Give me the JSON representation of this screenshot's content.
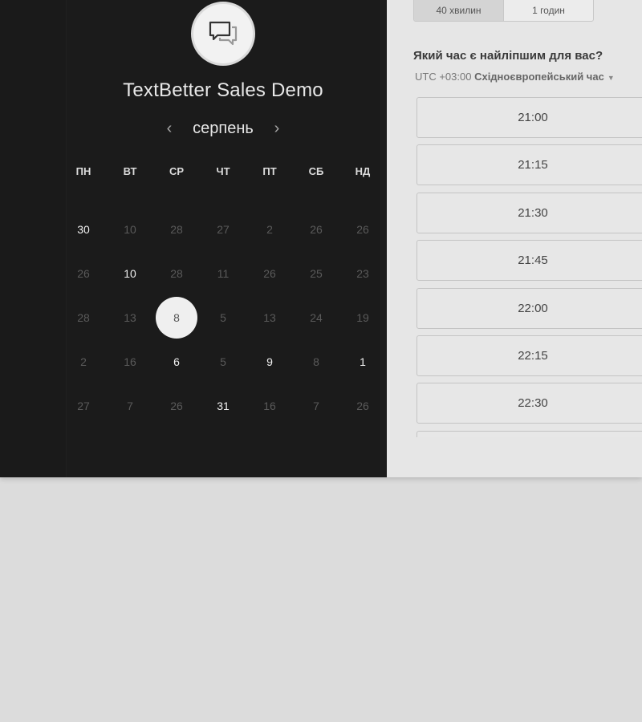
{
  "event": {
    "title": "TextBetter Sales Demo",
    "avatar_icon": "chat-bubbles-icon"
  },
  "calendar": {
    "month": "серпень",
    "weekdays": [
      "ПН",
      "ВТ",
      "СР",
      "ЧТ",
      "ПТ",
      "СБ",
      "НД"
    ],
    "weeks": [
      [
        {
          "d": "30",
          "on": true
        },
        {
          "d": "10",
          "on": false
        },
        {
          "d": "28",
          "on": false
        },
        {
          "d": "27",
          "on": false
        },
        {
          "d": "2",
          "on": false
        },
        {
          "d": "26",
          "on": false
        },
        {
          "d": "26",
          "on": false
        }
      ],
      [
        {
          "d": "26",
          "on": false
        },
        {
          "d": "10",
          "on": true
        },
        {
          "d": "28",
          "on": false
        },
        {
          "d": "11",
          "on": false
        },
        {
          "d": "26",
          "on": false
        },
        {
          "d": "25",
          "on": false
        },
        {
          "d": "23",
          "on": false
        }
      ],
      [
        {
          "d": "28",
          "on": false
        },
        {
          "d": "13",
          "on": false
        },
        {
          "d": "8",
          "on": true,
          "selected": true
        },
        {
          "d": "5",
          "on": false
        },
        {
          "d": "13",
          "on": false
        },
        {
          "d": "24",
          "on": false
        },
        {
          "d": "19",
          "on": false
        }
      ],
      [
        {
          "d": "2",
          "on": false
        },
        {
          "d": "16",
          "on": false
        },
        {
          "d": "6",
          "on": true
        },
        {
          "d": "5",
          "on": false
        },
        {
          "d": "9",
          "on": true
        },
        {
          "d": "8",
          "on": false
        },
        {
          "d": "1",
          "on": true
        }
      ],
      [
        {
          "d": "27",
          "on": false
        },
        {
          "d": "7",
          "on": false
        },
        {
          "d": "26",
          "on": false
        },
        {
          "d": "31",
          "on": true
        },
        {
          "d": "16",
          "on": false
        },
        {
          "d": "7",
          "on": false
        },
        {
          "d": "26",
          "on": false
        }
      ]
    ]
  },
  "duration": {
    "options": [
      "40 хвилин",
      "1 годин"
    ],
    "selected_index": 0
  },
  "times": {
    "question": "Який час є найліпшим для вас?",
    "tz_offset": "UTC +03:00",
    "tz_name": "Східноєвропейський час",
    "slots": [
      "21:00",
      "21:15",
      "21:30",
      "21:45",
      "22:00",
      "22:15",
      "22:30",
      ""
    ]
  }
}
